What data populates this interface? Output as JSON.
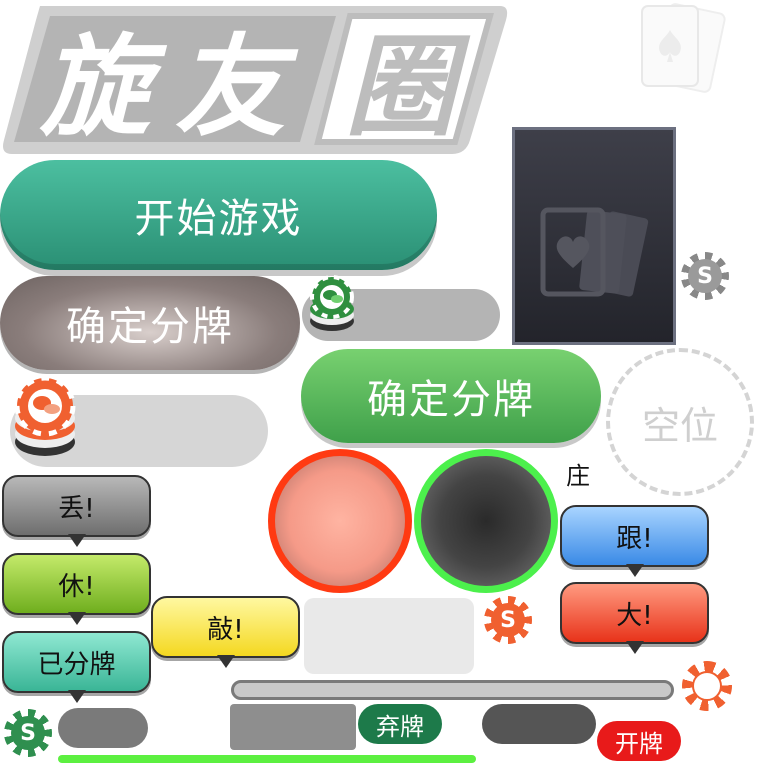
{
  "logo": {
    "chars": [
      "旋",
      "友",
      "圈"
    ]
  },
  "buttons": {
    "start_game": "开始游戏",
    "confirm_split_gray": "确定分牌",
    "confirm_split_green": "确定分牌"
  },
  "seat": {
    "empty_label": "空位",
    "dealer_label": "庄"
  },
  "bubbles": {
    "diu": "丢!",
    "xiu": "休!",
    "yifenpai": "已分牌",
    "qiao": "敲!",
    "gen": "跟!",
    "da": "大!"
  },
  "tags": {
    "fold": "弃牌",
    "open": "开牌"
  },
  "chip_symbol": "S",
  "colors": {
    "teal": "#3aa58a",
    "green": "#5cb85c",
    "red": "#ff4422",
    "bright_green": "#44ee44",
    "card_dark": "#2f3038"
  }
}
